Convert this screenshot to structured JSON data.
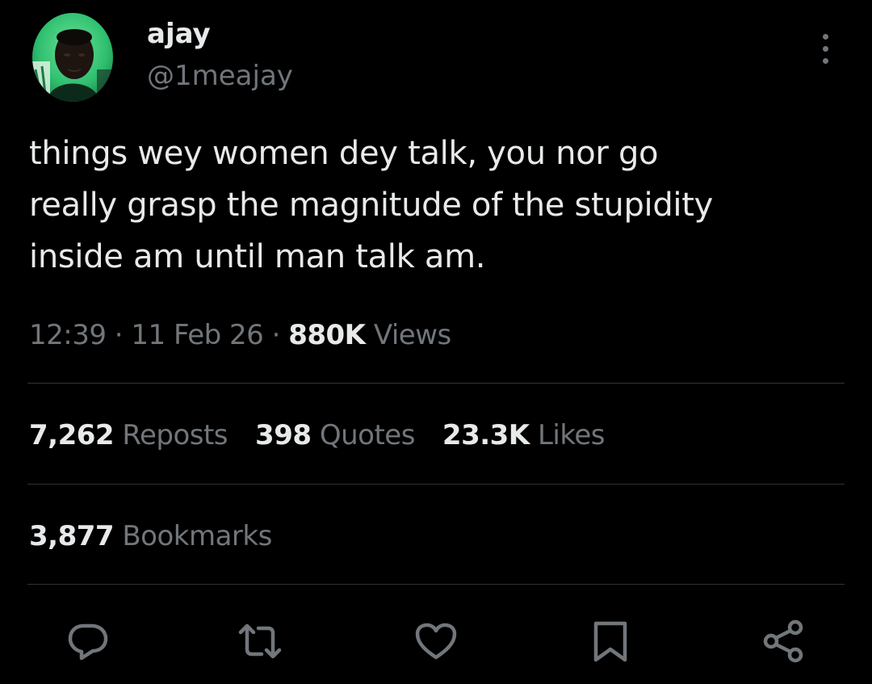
{
  "user": {
    "display_name": "ajay",
    "handle": "@1meajay",
    "avatar_icon": "profile-photo"
  },
  "tweet": {
    "text_lines": [
      "things wey women dey talk, you nor go",
      "really grasp the magnitude of the stupidity",
      "inside am until man talk am."
    ]
  },
  "meta": {
    "time": "12:39",
    "separator": "·",
    "date": "11 Feb 26",
    "views_count": "880K",
    "views_label": "Views"
  },
  "stats": {
    "reposts_count": "7,262",
    "reposts_label": "Reposts",
    "quotes_count": "398",
    "quotes_label": "Quotes",
    "likes_count": "23.3K",
    "likes_label": "Likes",
    "bookmarks_count": "3,877",
    "bookmarks_label": "Bookmarks"
  },
  "actions": [
    "reply-icon",
    "repost-icon",
    "like-icon",
    "bookmark-icon",
    "share-icon"
  ],
  "colors": {
    "background": "#000000",
    "text_primary": "#e7e9ea",
    "text_secondary": "#71767b",
    "divider": "#2f3336",
    "avatar_tint": "#2fbf6f"
  }
}
